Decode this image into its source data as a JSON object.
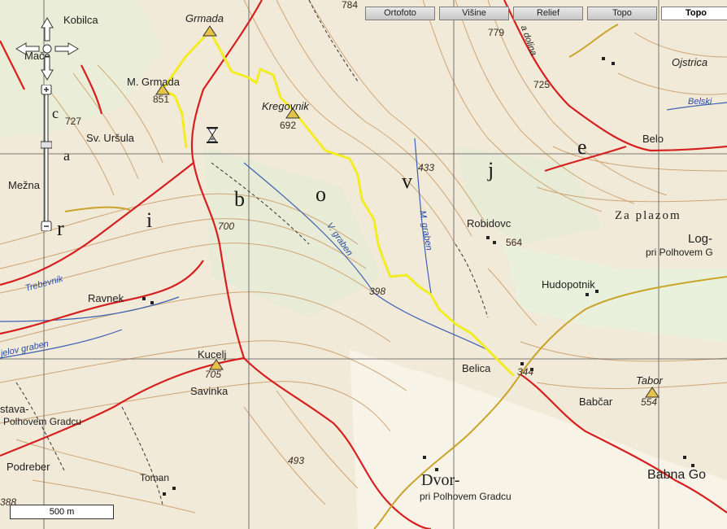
{
  "tabs": [
    {
      "label": "Ortofoto",
      "active": false
    },
    {
      "label": "Višine",
      "active": false
    },
    {
      "label": "Relief",
      "active": false
    },
    {
      "label": "Topo",
      "active": false
    },
    {
      "label": "Topo",
      "active": true
    }
  ],
  "scale_bar": {
    "label": "500 m"
  },
  "icons": {
    "pan": "pan-arrows-icon",
    "zoom_in": "plus-icon",
    "zoom_out": "minus-icon",
    "loading": "hourglass-icon"
  },
  "colors": {
    "route": "#f2ec22",
    "road": "#d61f1f",
    "minor_road": "#caa42a",
    "contour": "#c7945e",
    "stream": "#3e5fb4",
    "grid": "#555555"
  },
  "labels": {
    "kobilca": "Kobilca",
    "grmada": "Grmada",
    "mace": "Mače",
    "m_grmada": "M. Grmada",
    "elev_851": "851",
    "elev_727": "727",
    "sv_ursula": "Sv. Uršula",
    "kregovnik": "Kregovnik",
    "elev_692": "692",
    "elev_784": "784",
    "elev_779": "779",
    "dolina": "a dolina",
    "elev_725": "725",
    "ojstrica": "Ojstrica",
    "belski": "Belski",
    "belo": "Belo",
    "mezna": "Mežna",
    "elev_700": "700",
    "v_graben": "V. graben",
    "m_graben": "M. graben",
    "elev_433": "433",
    "robidovc": "Robidovc",
    "elev_564": "564",
    "za_plazom": "Za plazom",
    "log": "Log-",
    "pri_polhovem_1": "pri Polhovem G",
    "hudopotnik": "Hudopotnik",
    "trebevnik": "Trebevnik",
    "ravnek": "Ravnek",
    "elev_398": "398",
    "jelov_graben": "jelov graben",
    "kucelj": "Kucelj",
    "elev_705": "705",
    "belica": "Belica",
    "elev_344": "344",
    "tabor": "Tabor",
    "elev_554": "554",
    "stava": "stava-",
    "pri_polhovem_2": "Polhovem Gradcu",
    "savinka": "Savinka",
    "babcar": "Babčar",
    "podreber": "Podreber",
    "elev_493": "493",
    "toman": "Toman",
    "elev_388": "388",
    "dvor": "Dvor-",
    "pri_polhovem_3": "pri Polhovem Gradcu",
    "babna": "Babna Go",
    "big_b": "b",
    "big_o": "o",
    "big_v": "v",
    "big_j": "j",
    "big_e": "e",
    "big_i": "i",
    "big_r": "r",
    "big_a": "a",
    "big_c": "c"
  }
}
